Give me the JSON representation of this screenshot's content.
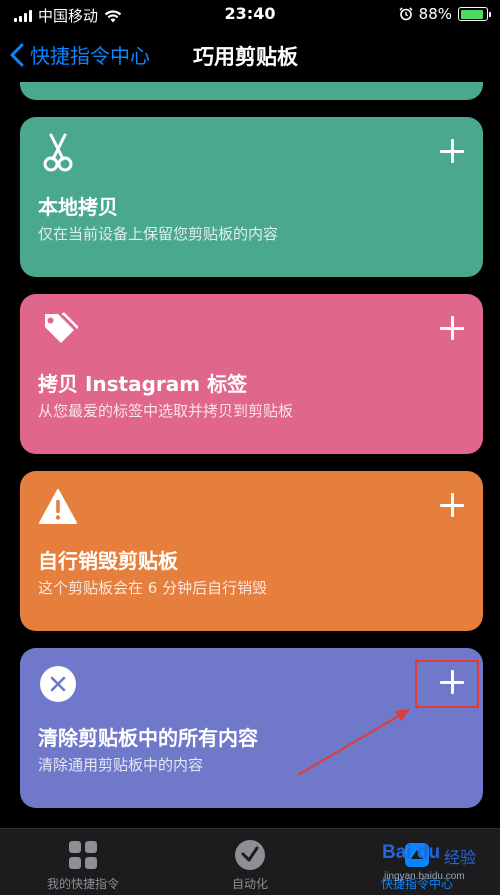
{
  "status_bar": {
    "carrier": "中国移动",
    "time": "23:40",
    "battery_percent": "88%",
    "battery_level": 0.88
  },
  "nav": {
    "back_label": "快捷指令中心",
    "title": "巧用剪贴板"
  },
  "cards": [
    {
      "icon": "scissors-icon",
      "title": "本地拷贝",
      "subtitle": "仅在当前设备上保留您剪贴板的内容",
      "color": "#4aa88e"
    },
    {
      "icon": "tag-icon",
      "title": "拷贝 Instagram 标签",
      "subtitle": "从您最爱的标签中选取并拷贝到剪贴板",
      "color": "#e0668c"
    },
    {
      "icon": "warning-icon",
      "title": "自行销毁剪贴板",
      "subtitle": "这个剪贴板会在 6 分钟后自行销毁",
      "color": "#e67f3d"
    },
    {
      "icon": "clear-icon",
      "title": "清除剪贴板中的所有内容",
      "subtitle": "清除通用剪贴板中的内容",
      "color": "#6f78c9"
    }
  ],
  "tabs": [
    {
      "label": "我的快捷指令",
      "icon": "grid-icon"
    },
    {
      "label": "自动化",
      "icon": "clock-icon"
    },
    {
      "label": "快捷指令中心",
      "icon": "gallery-icon"
    }
  ],
  "watermark": {
    "logo": "Bai du",
    "brand": "经验",
    "url": "jingyan.baidu.com"
  },
  "colors": {
    "accent": "#0a84ff",
    "annotation": "#e53935"
  }
}
